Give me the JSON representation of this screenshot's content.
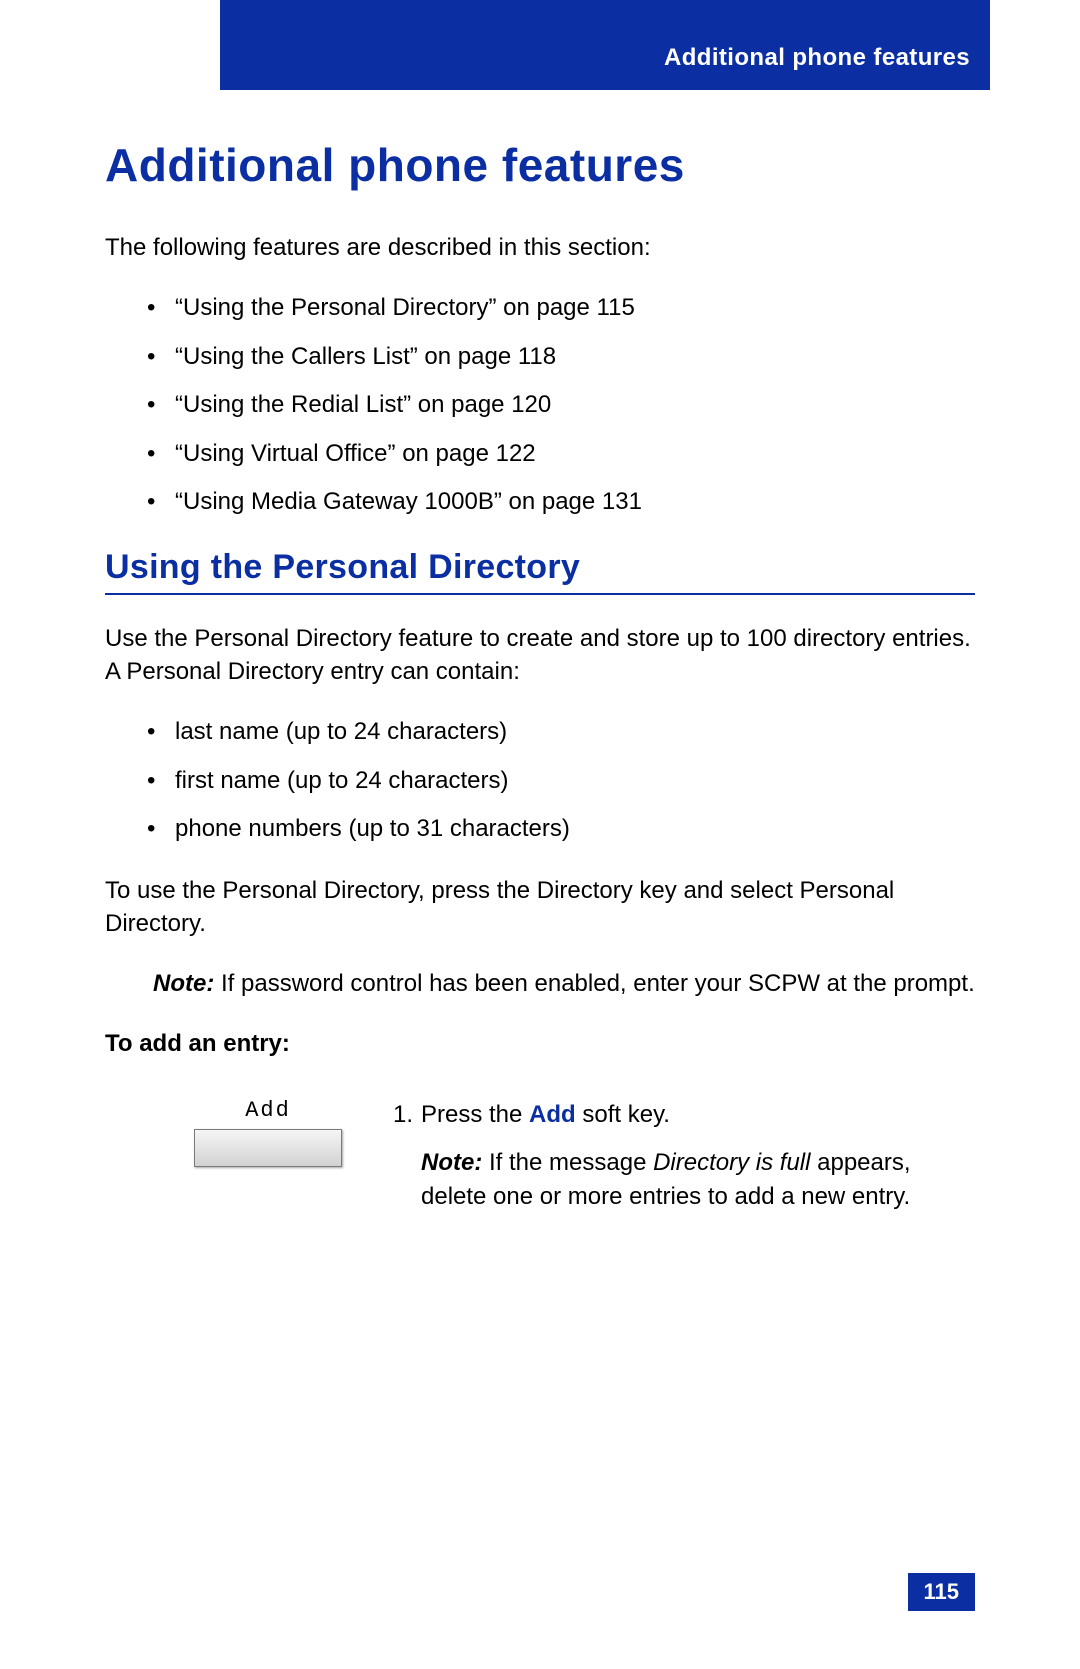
{
  "header": {
    "running_title": "Additional phone features"
  },
  "title": "Additional phone features",
  "intro": "The following features are described in this section:",
  "toc_items": [
    "“Using the Personal Directory” on page 115",
    "“Using the Callers List” on page 118",
    "“Using the Redial List” on page 120",
    "“Using Virtual Office” on page 122",
    "“Using Media Gateway 1000B” on page 131"
  ],
  "section_title": "Using the Personal Directory",
  "section_intro": "Use the Personal Directory feature to create and store up to 100 directory entries. A Personal Directory entry can contain:",
  "pd_items": [
    "last name (up to 24 characters)",
    "first name (up to 24 characters)",
    "phone numbers (up to 31 characters)"
  ],
  "pd_use": "To use the Personal Directory, press the Directory key and select Personal Directory.",
  "pd_note_label": "Note:",
  "pd_note_body": " If password control has been enabled, enter your SCPW at the prompt.",
  "to_add": "To add an entry:",
  "softkey": {
    "label": "Add",
    "step_num": "1.",
    "step_pre": "Press the ",
    "step_name": "Add",
    "step_post": " soft key.",
    "note_label": "Note:",
    "note_pre": " If the message ",
    "note_msg": "Directory is full",
    "note_post": " appears, delete one or more entries to add a new entry."
  },
  "page_number": "115"
}
